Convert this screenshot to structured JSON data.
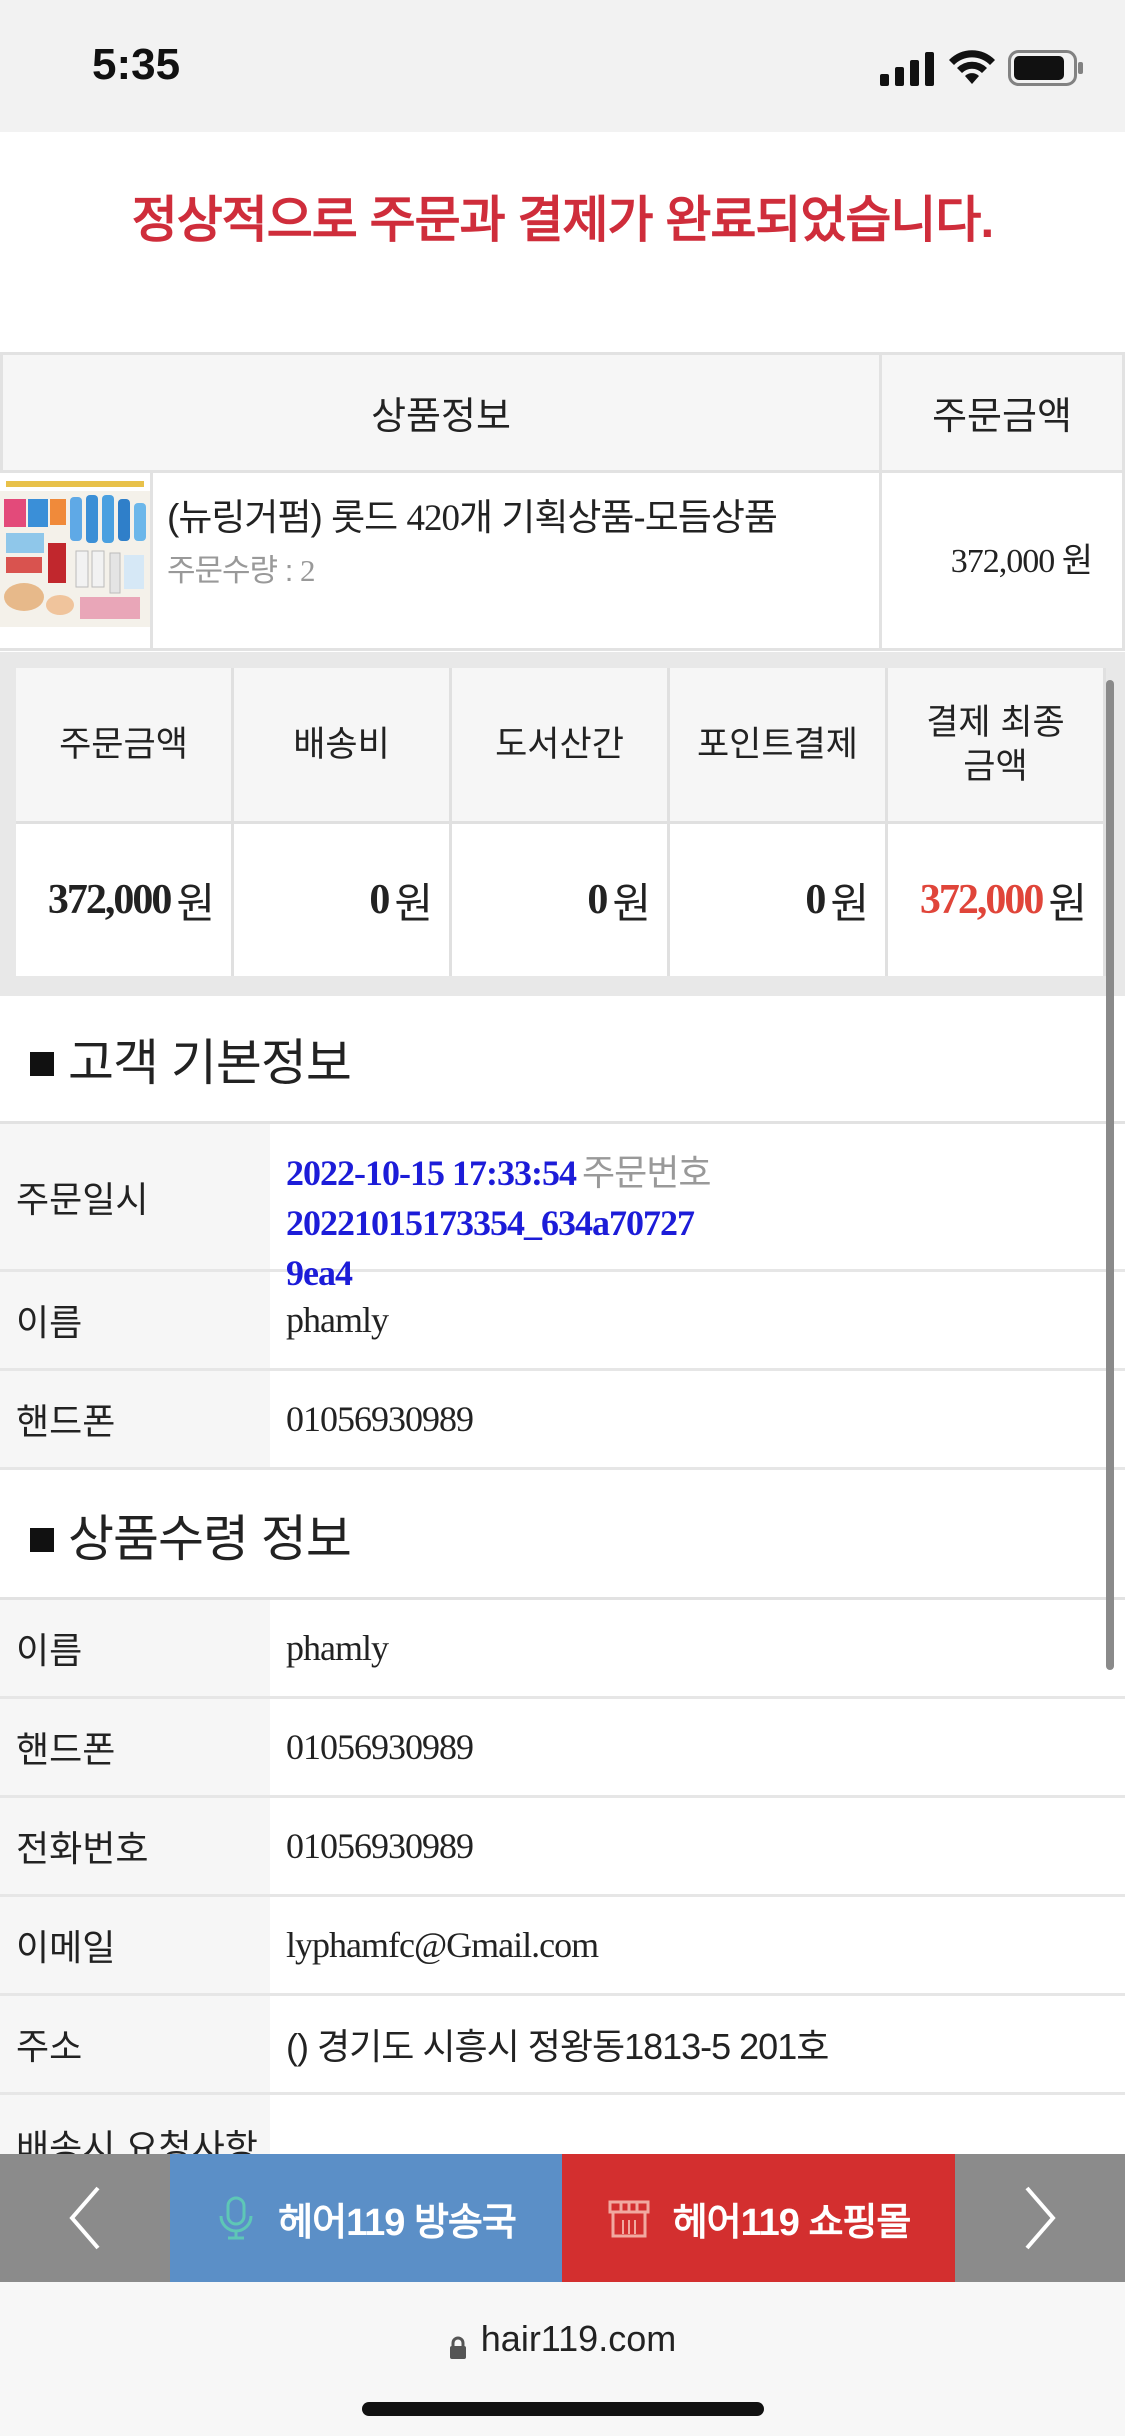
{
  "status": {
    "time": "5:35"
  },
  "success_message": "정상적으로 주문과 결제가 완료되었습니다.",
  "product_table": {
    "header_product": "상품정보",
    "header_amount": "주문금액",
    "product": {
      "name_prefix": "(뉴링거펌) 롯드",
      "name_num": "420",
      "name_suffix": "개 기획상품-모듬상품",
      "qty_label": "주문수량 :",
      "qty": "2",
      "price": "372,000",
      "price_unit": "원"
    }
  },
  "summary": {
    "headers": [
      "주문금액",
      "배송비",
      "도서산간",
      "포인트결제",
      "결제 최종\n금액"
    ],
    "values": [
      "372,000",
      "0",
      "0",
      "0",
      "372,000"
    ],
    "unit": "원",
    "highlight_color": "#e0453a"
  },
  "customer_section": {
    "title": "고객 기본정보",
    "order_date_label": "주문일시",
    "order_date": "2022-10-15 17:33:54",
    "order_no_label": "주문번호",
    "order_no_line1": "20221015173354_634a70727",
    "order_no_line2": "9ea4",
    "name_label": "이름",
    "name": "phamly",
    "phone_label": "핸드폰",
    "phone": "01056930989"
  },
  "receiver_section": {
    "title": "상품수령 정보",
    "rows": [
      {
        "label": "이름",
        "value": "phamly"
      },
      {
        "label": "핸드폰",
        "value": "01056930989"
      },
      {
        "label": "전화번호",
        "value": "01056930989"
      },
      {
        "label": "이메일",
        "value": "lyphamfc@Gmail.com"
      },
      {
        "label": "주소",
        "value": "() 경기도 시흥시 정왕동1813-5 201호"
      },
      {
        "label": "배송시 요청사항",
        "value": ""
      }
    ]
  },
  "bottom_nav": {
    "broadcast_label": "헤어119 방송국",
    "shop_label": "헤어119 쇼핑몰",
    "broadcast_color": "#5b8fc7",
    "shop_color": "#d32f2f"
  },
  "browser": {
    "url": "hair119.com"
  }
}
